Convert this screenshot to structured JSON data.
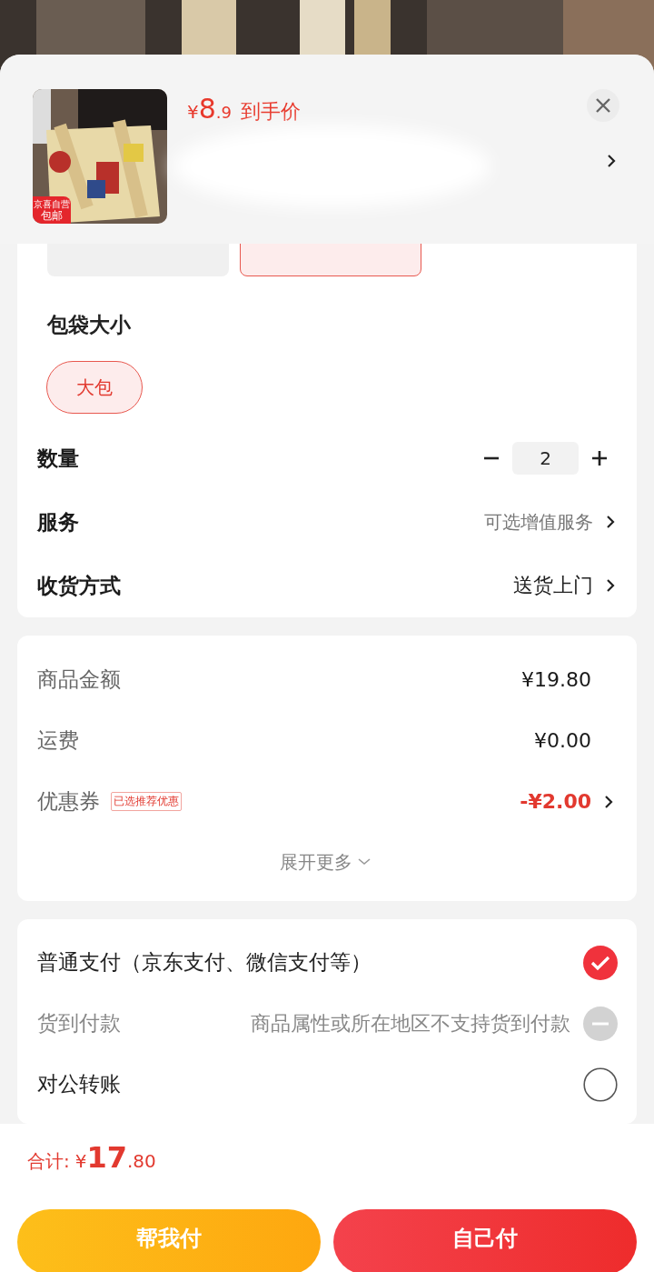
{
  "header": {
    "badge_top": "京喜自营",
    "badge_bottom": "包邮",
    "price_symbol": "¥",
    "price_int": "8",
    "price_dec": ".9",
    "price_label": "到手价"
  },
  "color_options": [
    {
      "selected": false
    },
    {
      "selected": true
    }
  ],
  "size_group": {
    "title": "包袋大小",
    "options": [
      {
        "label": "大包",
        "selected": true
      }
    ]
  },
  "quantity": {
    "label": "数量",
    "value": "2"
  },
  "rows": [
    {
      "label": "服务",
      "value": "可选增值服务",
      "kind": "muted"
    },
    {
      "label": "收货方式",
      "value": "送货上门",
      "kind": "strong"
    }
  ],
  "summary": [
    {
      "label": "商品金额",
      "value": "¥19.80",
      "kind": "plain"
    },
    {
      "label": "运费",
      "value": "¥0.00",
      "kind": "plain"
    },
    {
      "label": "优惠券",
      "tag": "已选推荐优惠",
      "value": "-¥2.00",
      "kind": "discount"
    }
  ],
  "expand": "展开更多",
  "payments": [
    {
      "label": "普通支付（京东支付、微信支付等）",
      "selected": true,
      "disabled": false
    },
    {
      "label": "货到付款",
      "note": "商品属性或所在地区不支持货到付款",
      "selected": false,
      "disabled": true
    },
    {
      "label": "对公转账",
      "selected": false,
      "disabled": false
    }
  ],
  "total": {
    "label": "合计:",
    "symbol": "¥",
    "int": "17",
    "dec": ".80"
  },
  "buttons": [
    {
      "label": "帮我付",
      "kind": "secondary"
    },
    {
      "label": "自己付",
      "kind": "primary"
    }
  ]
}
